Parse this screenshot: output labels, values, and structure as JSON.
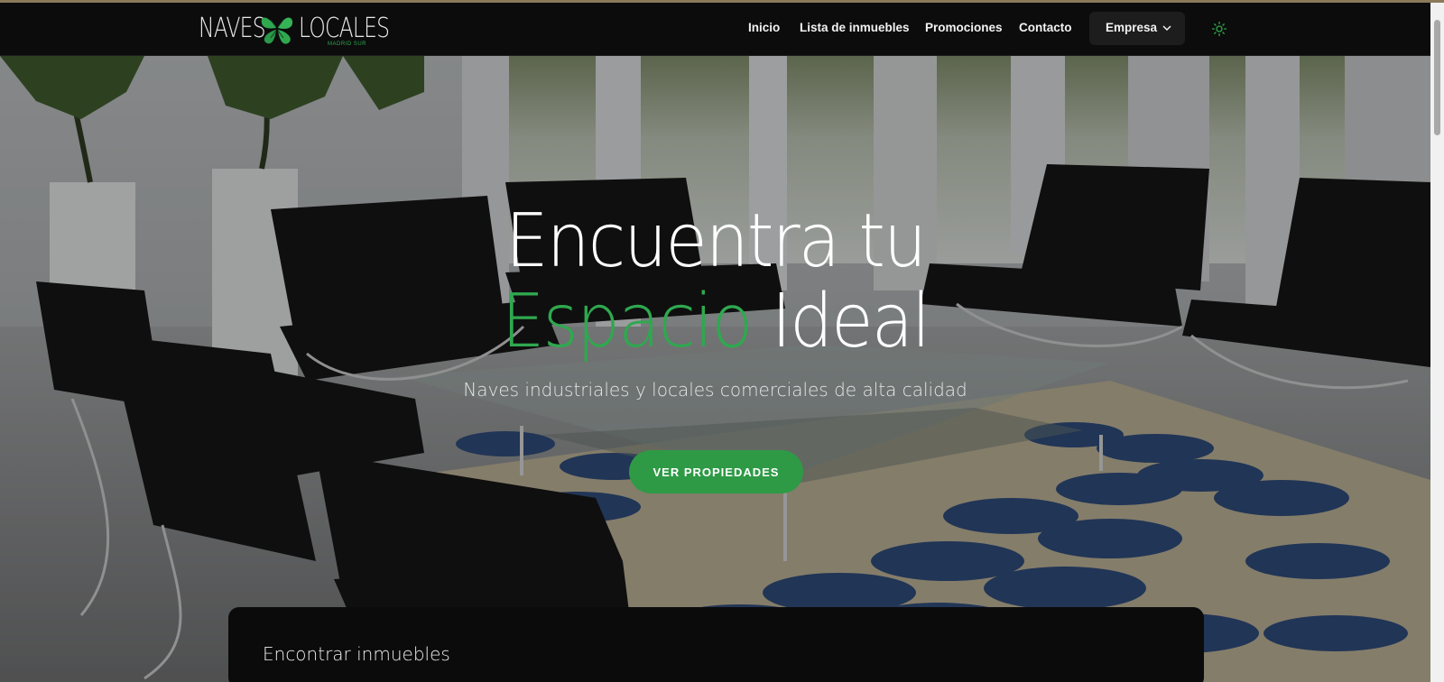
{
  "brand": {
    "name_left": "NAVES",
    "name_right": "LOCALES",
    "tagline": "MADRID SUR",
    "accent_color": "#2fa84f"
  },
  "nav": {
    "items": [
      {
        "label": "Inicio"
      },
      {
        "label": "Lista de inmuebles"
      },
      {
        "label": "Promociones"
      },
      {
        "label": "Contacto"
      }
    ],
    "dropdown_label": "Empresa",
    "theme_toggle_icon": "sun-icon"
  },
  "hero": {
    "title_line1": "Encuentra tu",
    "title_accent": "Espacio",
    "title_rest": "Ideal",
    "subtitle": "Naves industriales y locales comerciales de alta calidad",
    "cta_label": "VER PROPIEDADES",
    "cta_color": "#2e9a45"
  },
  "search": {
    "title": "Encontrar inmuebles"
  }
}
